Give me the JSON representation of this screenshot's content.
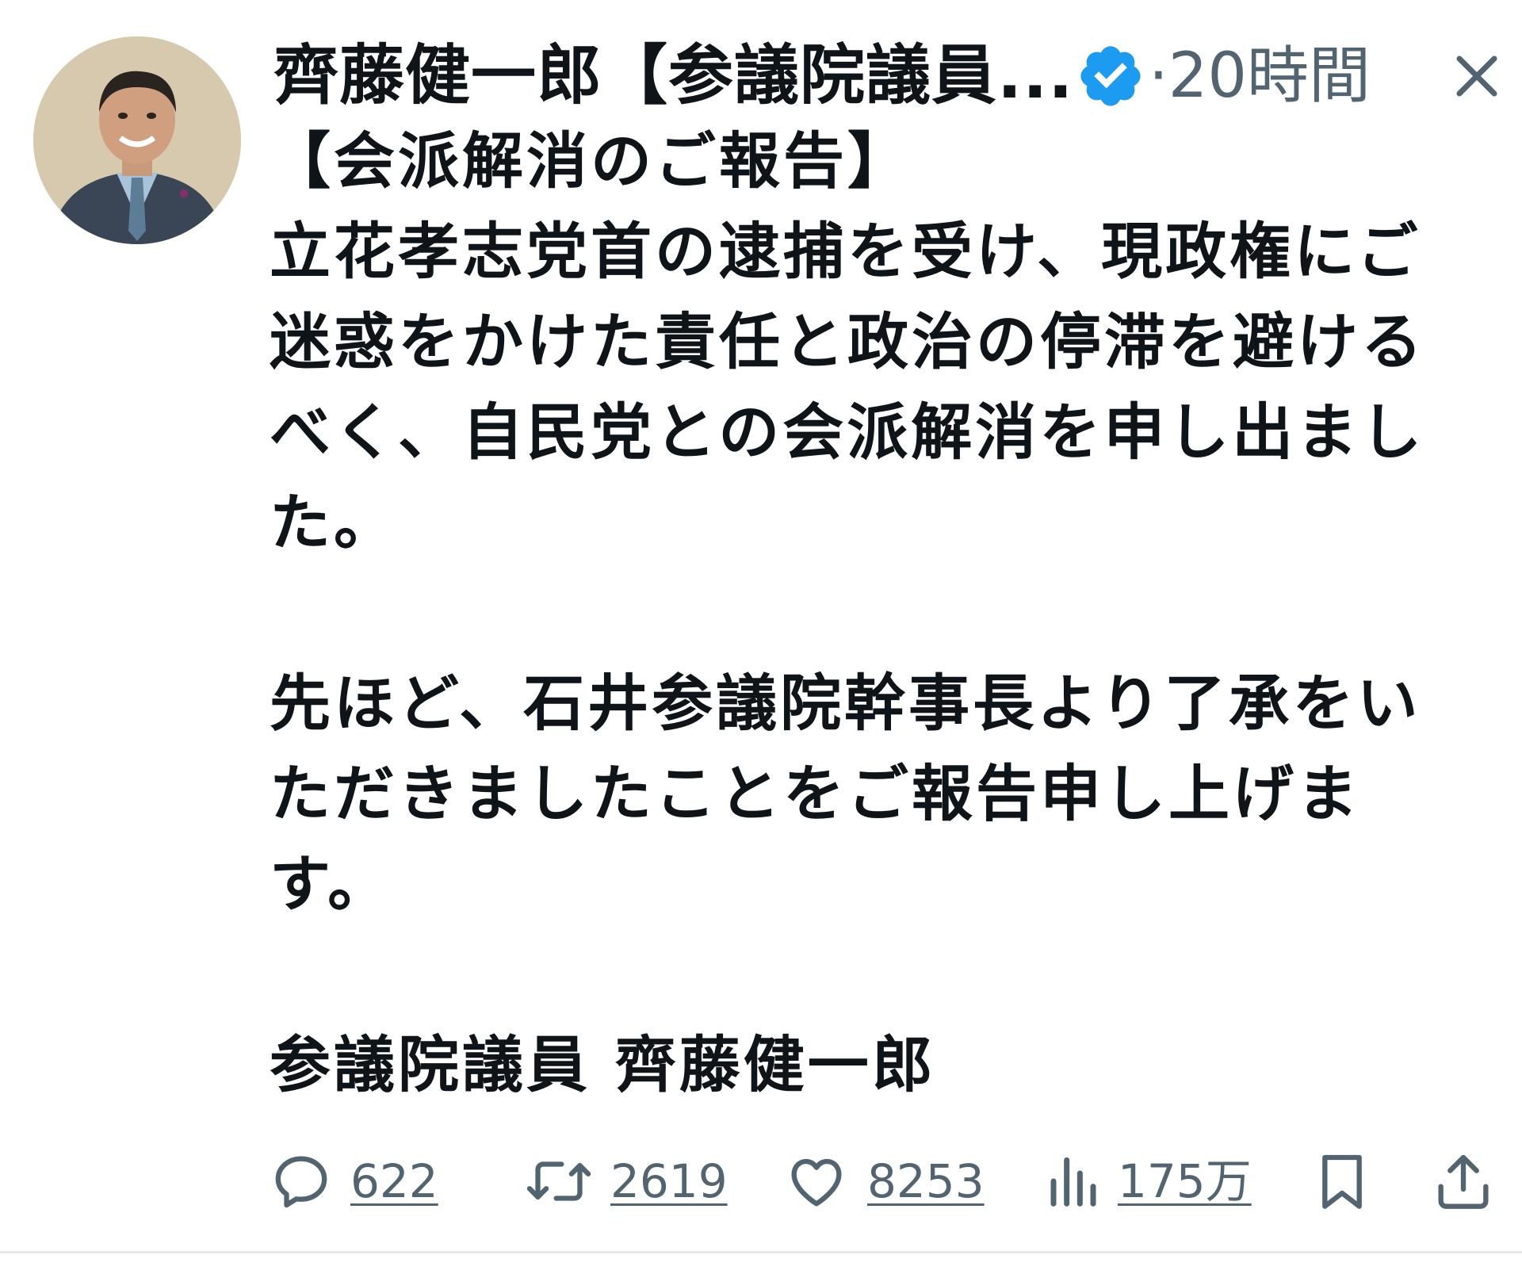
{
  "author": {
    "name": "齊藤健一郎【参議院議員...",
    "verified": true,
    "verified_color": "#1d9bf0",
    "timestamp": "·20時間"
  },
  "tweet": {
    "text": "【会派解消のご報告】\n立花孝志党首の逮捕を受け、現政権にご\n迷惑をかけた責任と政治の停滞を避ける\nべく、自民党との会派解消を申し出まし\nた。\n\n先ほど、石井参議院幹事長より了承をい\nただきましたことをご報告申し上げま\nす。\n\n参議院議員 齊藤健一郎"
  },
  "actions": {
    "reply_count": "622",
    "retweet_count": "2619",
    "like_count": "8253",
    "views_count": "175万"
  },
  "icons": {
    "close": "close-icon",
    "verified": "verified-badge-icon",
    "reply": "reply-icon",
    "retweet": "retweet-icon",
    "like": "heart-icon",
    "views": "views-chart-icon",
    "bookmark": "bookmark-icon",
    "share": "share-icon"
  },
  "colors": {
    "text": "#0f1419",
    "secondary": "#536471",
    "accent": "#1d9bf0"
  }
}
